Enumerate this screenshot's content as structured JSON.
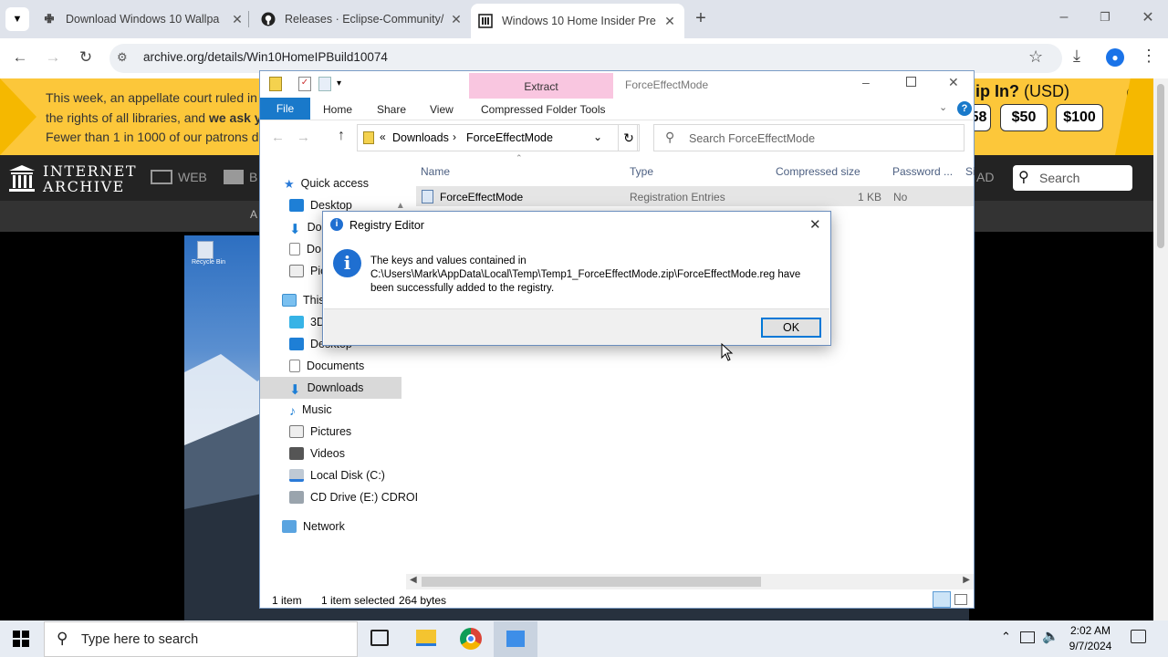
{
  "browser": {
    "tabs": [
      {
        "label": "Download Windows 10 Wallpa",
        "icon": "download-site-icon"
      },
      {
        "label": "Releases · Eclipse-Community/",
        "icon": "github-icon"
      },
      {
        "label": "Windows 10 Home Insider Pre",
        "icon": "archive-icon"
      }
    ],
    "url": "archive.org/details/Win10HomeIPBuild10074"
  },
  "banner": {
    "line1_a": "This week, an appellate court ruled in",
    "line2_a": "the rights of all libraries, and ",
    "line2_bold": "we ask y",
    "line3_a": "Fewer than 1 in 1000 of our patrons d",
    "right_bold": "ip In?",
    "right_rest": " (USD)",
    "amounts": [
      "58",
      "$50",
      "$100"
    ]
  },
  "ia": {
    "logo_line1": "INTERNET",
    "logo_line2": "ARCHIVE",
    "nav_web": "WEB",
    "nav_b": "B",
    "nav_right": "AD",
    "subnav": "A",
    "search_placeholder": "Search"
  },
  "desktop": {
    "recycle_label": "Recycle Bin"
  },
  "explorer": {
    "context_tab": "Extract",
    "window_title": "ForceEffectMode",
    "ribbon_tabs": [
      "File",
      "Home",
      "Share",
      "View",
      "Compressed Folder Tools"
    ],
    "breadcrumb": [
      "Downloads",
      "ForceEffectMode"
    ],
    "breadcrumb_prefix": "«",
    "search_placeholder": "Search ForceEffectMode",
    "nav": {
      "quick_access": "Quick access",
      "desktop": "Desktop",
      "downloads_short": "Do",
      "documents_short": "Do",
      "pictures_short": "Pic",
      "this_pc": "This",
      "objects3d": "3D",
      "desktop2": "Desktop",
      "documents": "Documents",
      "downloads": "Downloads",
      "music": "Music",
      "pictures": "Pictures",
      "videos": "Videos",
      "local_disk": "Local Disk (C:)",
      "cd_drive": "CD Drive (E:) CDROI",
      "network": "Network"
    },
    "columns": [
      "Name",
      "Type",
      "Compressed size",
      "Password ...",
      "Si"
    ],
    "rows": [
      {
        "name": "ForceEffectMode",
        "type": "Registration Entries",
        "size": "1 KB",
        "password": "No"
      }
    ],
    "status": {
      "items": "1 item",
      "selected": "1 item selected",
      "bytes": "264 bytes"
    }
  },
  "dialog": {
    "title": "Registry Editor",
    "message_line1": "The keys and values contained in",
    "message_line2": "C:\\Users\\Mark\\AppData\\Local\\Temp\\Temp1_ForceEffectMode.zip\\ForceEffectMode.reg have",
    "message_line3": "been successfully added to the registry.",
    "ok_label": "OK"
  },
  "taskbar": {
    "search_placeholder": "Type here to search",
    "time": "2:02 AM",
    "date": "9/7/2024"
  }
}
